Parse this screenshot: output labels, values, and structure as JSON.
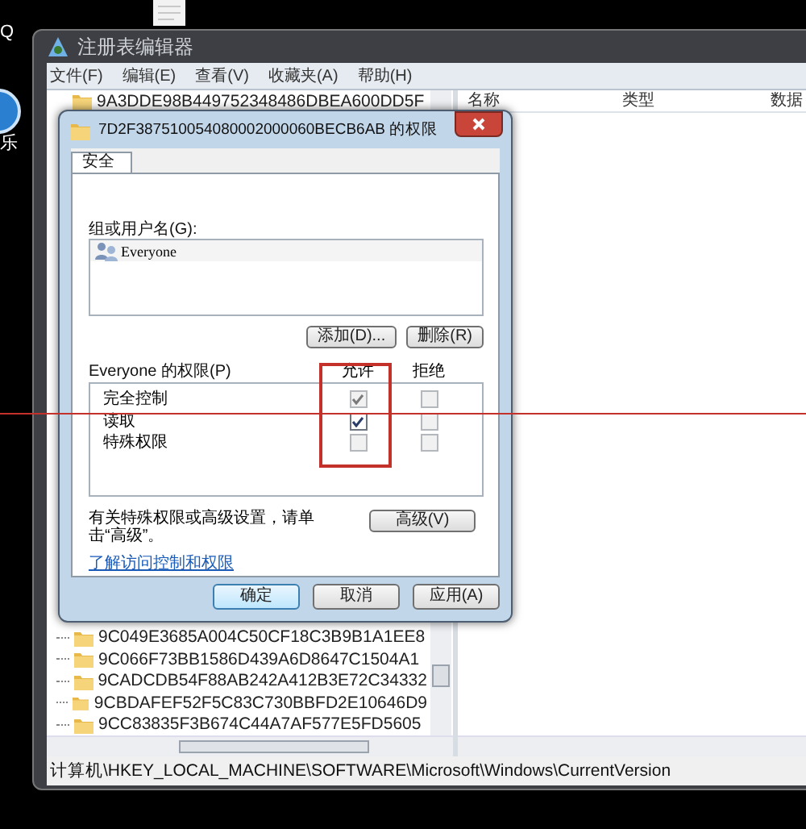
{
  "desktop": {
    "icons": [
      {
        "label": "Q"
      },
      {
        "label": "乐"
      }
    ]
  },
  "window": {
    "title": "注册表编辑器",
    "menu": [
      "文件(F)",
      "编辑(E)",
      "查看(V)",
      "收藏夹(A)",
      "帮助(H)"
    ],
    "tree_top": [
      "9A3DDE98B449752348486DBEA600DD5F"
    ],
    "tree_bottom": [
      "9C049E3685A004C50CF18C3B9B1A1EE8",
      "9C066F73BB1586D439A6D8647C1504A1",
      "9CADCDB54F88AB242A412B3E72C34332",
      "9CBDAFEF52F5C83C730BBFD2E10646D9",
      "9CC83835F3B674C44A7AF577E5FD5605"
    ],
    "columns": [
      "名称",
      "类型",
      "数据"
    ],
    "status_bar": "计算机\\HKEY_LOCAL_MACHINE\\SOFTWARE\\Microsoft\\Windows\\CurrentVersion"
  },
  "dialog": {
    "title": "7D2F387510054080002000060BECB6AB 的权限",
    "tabs": [
      {
        "label": "安全",
        "selected": true
      }
    ],
    "users_label": "组或用户名(G):",
    "users": [
      {
        "name": "Everyone"
      }
    ],
    "user_buttons": [
      "添加(D)...",
      "删除(R)"
    ],
    "permissions_label": "Everyone 的权限(P)",
    "allow_header": "允许",
    "deny_header": "拒绝",
    "permissions": [
      {
        "name": "完全控制",
        "allow": {
          "checked": true,
          "disabled": true
        },
        "deny": {
          "checked": false,
          "disabled": true
        }
      },
      {
        "name": "读取",
        "allow": {
          "checked": true,
          "disabled": false
        },
        "deny": {
          "checked": false,
          "disabled": true
        }
      },
      {
        "name": "特殊权限",
        "allow": {
          "checked": false,
          "disabled": true
        },
        "deny": {
          "checked": false,
          "disabled": true
        }
      }
    ],
    "advanced_note": "有关特殊权限或高级设置，请单击“高级”。",
    "advanced_button": "高级(V)",
    "link": "了解访问控制和权限",
    "buttons": [
      {
        "label": "确定",
        "default": true
      },
      {
        "label": "取消",
        "default": false
      },
      {
        "label": "应用(A)",
        "default": false
      }
    ]
  }
}
